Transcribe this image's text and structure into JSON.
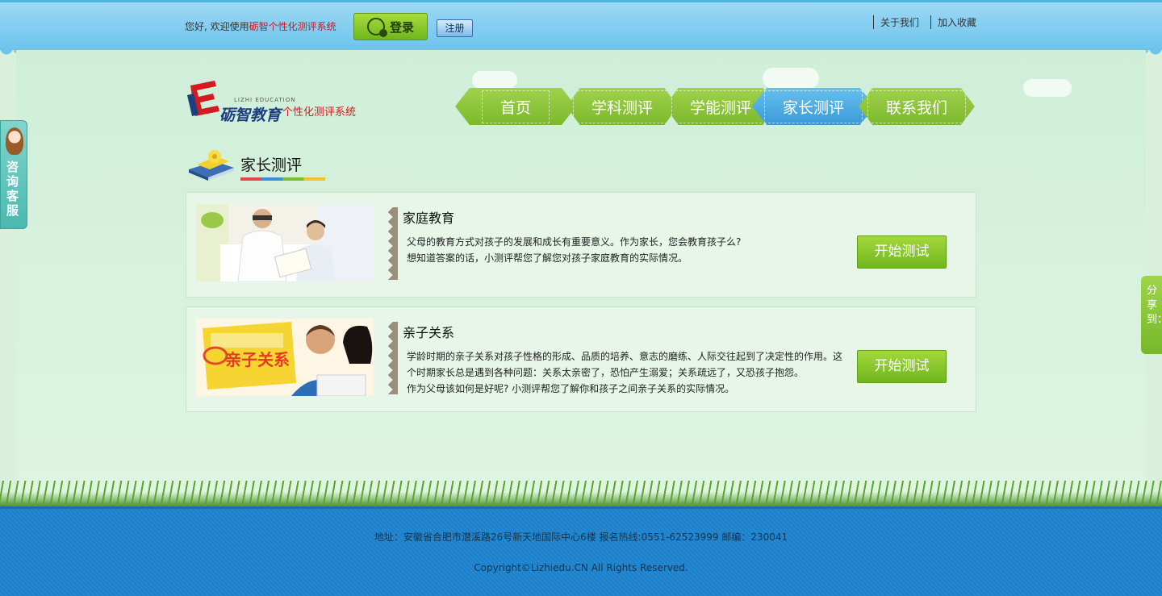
{
  "topbar": {
    "welcome_prefix": "您好, 欢迎使用",
    "welcome_brand": "砺智个性化测评系统",
    "login_label": "登录",
    "register_label": "注册",
    "links": [
      "关于我们",
      "加入收藏"
    ]
  },
  "logo": {
    "latin": "LIZHI EDUCATION",
    "name": "砺智教育",
    "subtitle": "个性化测评系统"
  },
  "nav": {
    "tabs": [
      {
        "label": "首页",
        "active": false
      },
      {
        "label": "学科测评",
        "active": false
      },
      {
        "label": "学能测评",
        "active": false
      },
      {
        "label": "家长测评",
        "active": true
      },
      {
        "label": "联系我们",
        "active": false
      }
    ]
  },
  "section": {
    "title": "家长测评"
  },
  "cards": [
    {
      "title": "家庭教育",
      "lines": [
        "父母的教育方式对孩子的发展和成长有重要意义。作为家长，您会教育孩子么?",
        "想知道答案的话，小测评帮您了解您对孩子家庭教育的实际情况。"
      ],
      "button": "开始测试"
    },
    {
      "title": "亲子关系",
      "image_text": "亲子关系",
      "lines": [
        "学龄时期的亲子关系对孩子性格的形成、品质的培养、意志的磨练、人际交往起到了决定性的作用。这",
        "个时期家长总是遇到各种问题：关系太亲密了，恐怕产生溺爱；关系疏远了，又恐孩子抱怨。",
        "作为父母该如何是好呢? 小测评帮您了解你和孩子之间亲子关系的实际情况。"
      ],
      "button": "开始测试"
    }
  ],
  "side": {
    "consult_label": "咨询客服",
    "share_label": "分享到："
  },
  "footer": {
    "address": "地址：安徽省合肥市潜溪路26号新天地国际中心6楼 报名热线:0551-62523999 邮编：230041",
    "copyright": "Copyright©Lizhiedu.CN All Rights Reserved."
  },
  "colors": {
    "top_bar": "#6cc4ee",
    "nav_green": "#8cc63f",
    "nav_active_blue": "#3a9ad8",
    "button_green": "#7cbc26",
    "brand_red": "#d4141c",
    "footer_blue": "#2185cc"
  }
}
